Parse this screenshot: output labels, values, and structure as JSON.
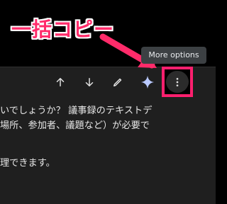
{
  "callout": {
    "text": "一括コピー",
    "color": "#ff2b6a"
  },
  "tooltip": {
    "text": "More options"
  },
  "toolbar": {
    "icons": [
      "arrow-up-icon",
      "arrow-down-icon",
      "pencil-icon",
      "sparkle-icon",
      "more-options-icon"
    ]
  },
  "content": {
    "line1": "いでしょうか？ 議事録のテキストデ",
    "line2": "場所、参加者、議題など）が必要で",
    "line3": "理できます。"
  },
  "colors": {
    "panel": "#1f1f1f",
    "text": "#e6e6e6",
    "highlight": "#ff1f6e",
    "tooltip_bg": "#3c4043"
  }
}
